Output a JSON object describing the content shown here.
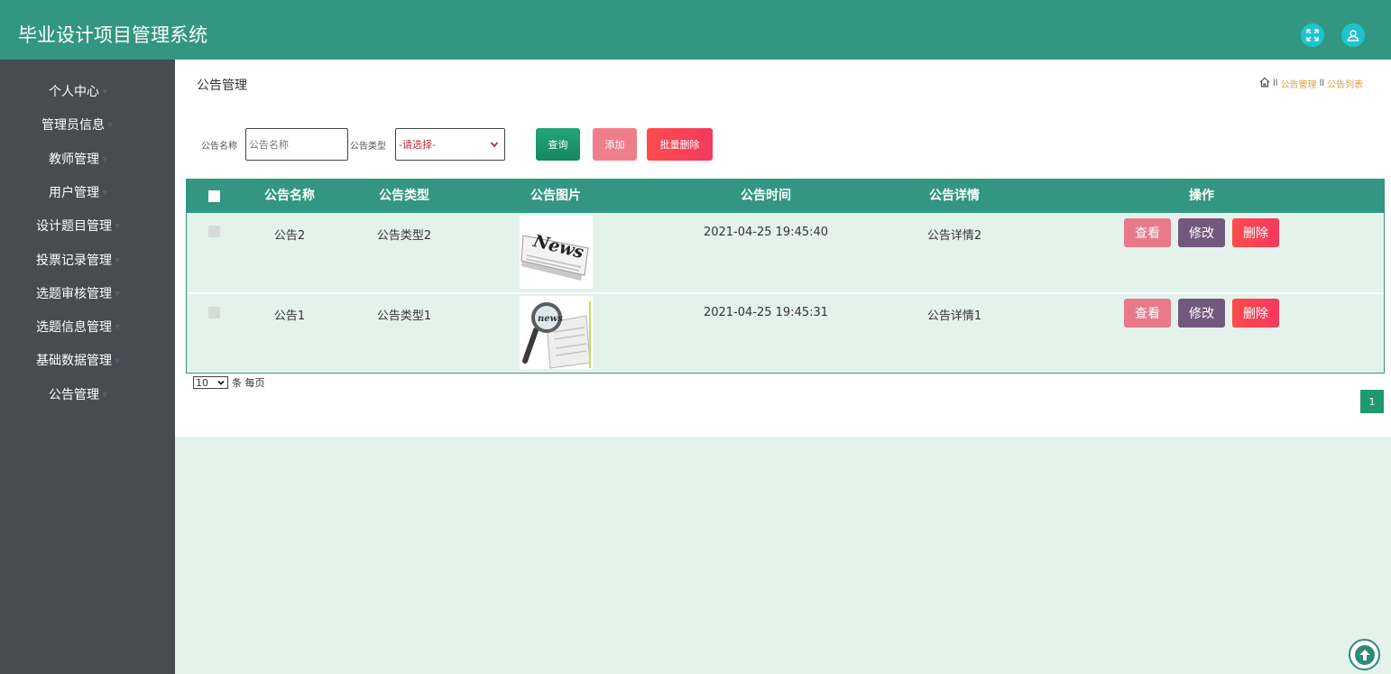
{
  "app": {
    "title": "毕业设计项目管理系统"
  },
  "header": {
    "icons": [
      "fullscreen-icon",
      "user-icon"
    ]
  },
  "colors": {
    "topbar": "#339683",
    "sidebar": "#454c52",
    "accent_green": "#1f9a6f",
    "danger": "#f5395f",
    "content_bg": "#e4f2ec"
  },
  "sidebar": {
    "items": [
      {
        "label": "个人中心"
      },
      {
        "label": "管理员信息"
      },
      {
        "label": "教师管理"
      },
      {
        "label": "用户管理"
      },
      {
        "label": "设计题目管理"
      },
      {
        "label": "投票记录管理"
      },
      {
        "label": "选题审核管理"
      },
      {
        "label": "选题信息管理"
      },
      {
        "label": "基础数据管理"
      },
      {
        "label": "公告管理"
      }
    ]
  },
  "main": {
    "title": "公告管理",
    "breadcrumb": [
      "公告管理",
      "公告列表"
    ]
  },
  "search": {
    "name_label": "公告名称",
    "name_placeholder": "公告名称",
    "type_label": "公告类型",
    "type_selected": "-请选择-",
    "query_label": "查询",
    "add_label": "添加",
    "batch_delete_label": "批量删除"
  },
  "table": {
    "headers": [
      "公告名称",
      "公告类型",
      "公告图片",
      "公告时间",
      "公告详情",
      "操作"
    ],
    "rows": [
      {
        "name": "公告2",
        "type": "公告类型2",
        "image": "news-newspaper-image",
        "time": "2021-04-25 19:45:40",
        "detail": "公告详情2"
      },
      {
        "name": "公告1",
        "type": "公告类型1",
        "image": "news-magnifier-image",
        "time": "2021-04-25 19:45:31",
        "detail": "公告详情1"
      }
    ],
    "actions": {
      "view": "查看",
      "edit": "修改",
      "delete": "删除"
    }
  },
  "pagination": {
    "page_size": "10",
    "page_size_suffix": "条 每页",
    "current_page": "1"
  }
}
